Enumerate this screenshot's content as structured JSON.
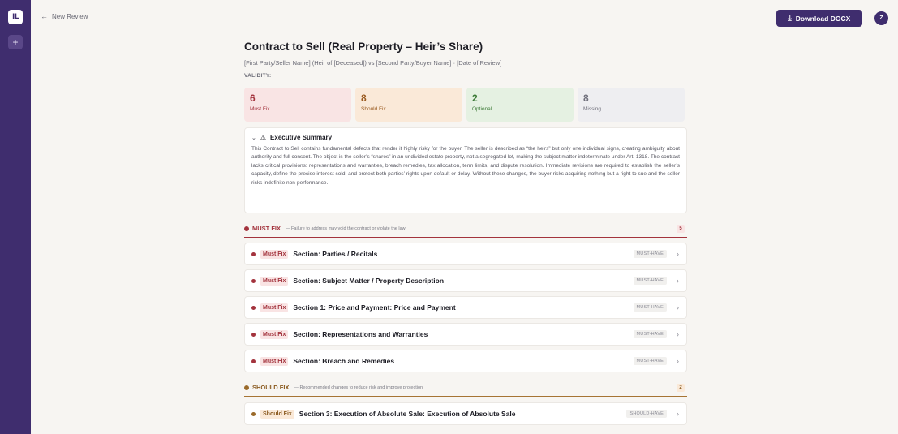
{
  "rail": {
    "logo": "IL",
    "new": "+"
  },
  "topbar": {
    "back_label": "New Review",
    "download_label": "Download DOCX",
    "avatar_initial": "Z"
  },
  "document": {
    "title": "Contract to Sell (Real Property – Heir’s Share)",
    "subtitle": "[First Party/Seller Name] (Heir of [Deceased]) vs [Second Party/Buyer Name] · [Date of Review]",
    "validity_label": "VALIDITY:"
  },
  "stats": [
    {
      "count": "6",
      "label": "Must Fix"
    },
    {
      "count": "8",
      "label": "Should Fix"
    },
    {
      "count": "2",
      "label": "Optional"
    },
    {
      "count": "8",
      "label": "Missing"
    }
  ],
  "summary": {
    "title": "Executive Summary",
    "body": "This Contract to Sell contains fundamental defects that render it highly risky for the buyer. The seller is described as “the heirs” but only one individual signs, creating ambiguity about authority and full consent. The object is the seller’s “shares” in an undivided estate property, not a segregated lot, making the subject matter indeterminate under Art. 1318. The contract lacks critical provisions: representations and warranties, breach remedies, tax allocation, term limits, and dispute resolution. Immediate revisions are required to establish the seller’s capacity, define the precise interest sold, and protect both parties’ rights upon default or delay. Without these changes, the buyer risks acquiring nothing but a right to sue and the seller risks indefinite non-performance. ---"
  },
  "must_fix": {
    "title": "MUST FIX",
    "description": "— Failure to address may void the contract or violate the law",
    "count": "5",
    "items": [
      {
        "badge": "Must Fix",
        "title": "Section: Parties / Recitals",
        "tag": "MUST-HAVE"
      },
      {
        "badge": "Must Fix",
        "title": "Section: Subject Matter / Property Description",
        "tag": "MUST-HAVE"
      },
      {
        "badge": "Must Fix",
        "title": "Section 1: Price and Payment: Price and Payment",
        "tag": "MUST-HAVE"
      },
      {
        "badge": "Must Fix",
        "title": "Section: Representations and Warranties",
        "tag": "MUST-HAVE"
      },
      {
        "badge": "Must Fix",
        "title": "Section: Breach and Remedies",
        "tag": "MUST-HAVE"
      }
    ]
  },
  "should_fix": {
    "title": "SHOULD FIX",
    "description": "— Recommended changes to reduce risk and improve protection",
    "count": "2",
    "items": [
      {
        "badge": "Should Fix",
        "title": "Section 3: Execution of Absolute Sale: Execution of Absolute Sale",
        "tag": "SHOULD-HAVE"
      }
    ]
  },
  "colors": {
    "brand": "#3f2d6e",
    "must": "#a3333d",
    "should": "#9a5a1f",
    "optional": "#3c7a37",
    "missing": "#70707c"
  },
  "icons": {
    "back": "arrow-left-icon",
    "download": "download-icon",
    "collapse": "chevron-down-icon",
    "warning": "warning-triangle-icon",
    "row": "chevron-right-icon"
  }
}
